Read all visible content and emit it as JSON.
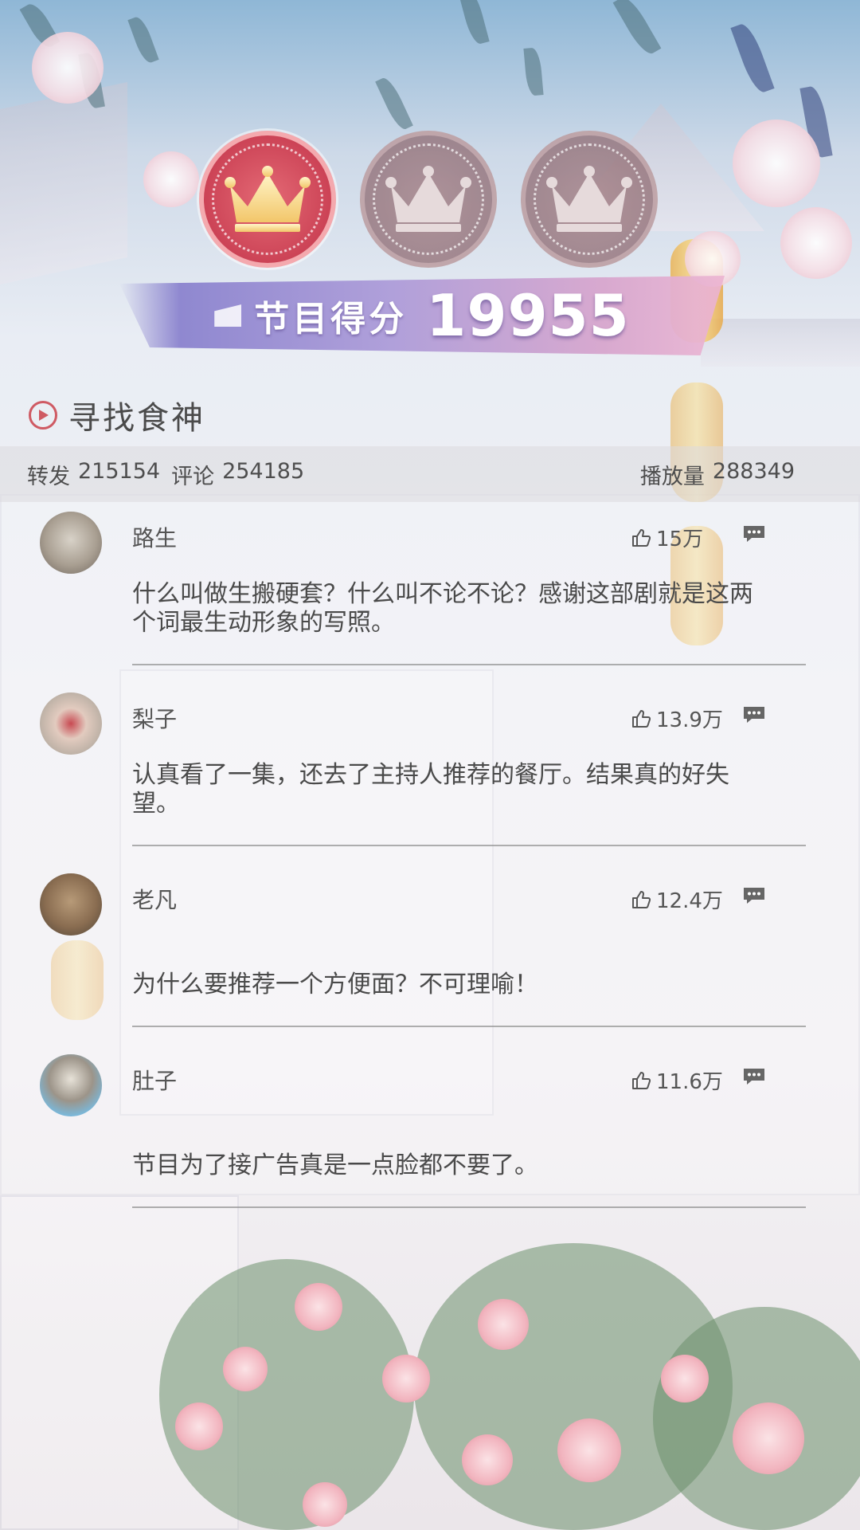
{
  "medals": [
    {
      "state": "active",
      "icon": "crown-icon"
    },
    {
      "state": "inactive",
      "icon": "crown-icon"
    },
    {
      "state": "inactive",
      "icon": "crown-icon"
    }
  ],
  "score": {
    "label": "节目得分",
    "value": "19955"
  },
  "show": {
    "title": "寻找食神"
  },
  "stats": {
    "repost_label": "转发",
    "repost_value": "215154",
    "comment_label": "评论",
    "comment_value": "254185",
    "plays_label": "播放量",
    "plays_value": "288349"
  },
  "comments": [
    {
      "name": "路生",
      "likes": "15万",
      "text": "什么叫做生搬硬套？什么叫不论不论？感谢这部剧就是这两个词最生动形象的写照。"
    },
    {
      "name": "梨子",
      "likes": "13.9万",
      "text": "认真看了一集，还去了主持人推荐的餐厅。结果真的好失望。"
    },
    {
      "name": "老凡",
      "likes": "12.4万",
      "text": "为什么要推荐一个方便面？不可理喻！"
    },
    {
      "name": "肚子",
      "likes": "11.6万",
      "text": "节目为了接广告真是一点脸都不要了。"
    }
  ],
  "colors": {
    "accent": "#cc4356",
    "ribbon": "#b0a0da",
    "text": "#4a4a4a"
  }
}
